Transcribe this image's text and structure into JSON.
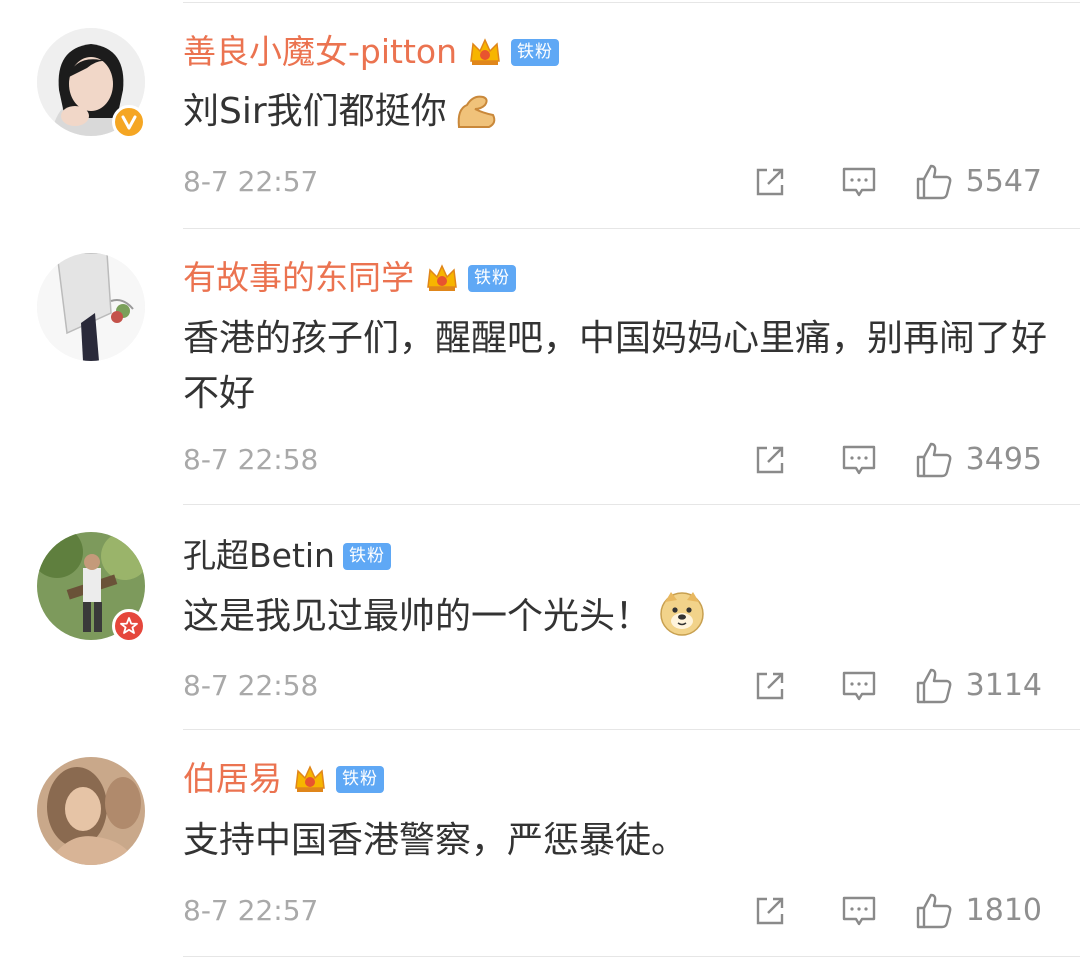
{
  "colors": {
    "vip_name": "#eb7350",
    "plain_name": "#333333",
    "badge_bg": "#5fa8f5",
    "meta": "#a9a9a9"
  },
  "comments": [
    {
      "username": "善良小魔女-pitton",
      "vip": true,
      "badge": "铁粉",
      "text": "刘Sir我们都挺你",
      "emoji": "flexed-biceps",
      "time": "8-7 22:57",
      "likes": "5547",
      "avatar_badge": "verified-gold"
    },
    {
      "username": "有故事的东同学",
      "vip": true,
      "badge": "铁粉",
      "text": "香港的孩子们，醒醒吧，中国妈妈心里痛，别再闹了好不好",
      "time": "8-7 22:58",
      "likes": "3495"
    },
    {
      "username": "孔超Betin",
      "vip": false,
      "badge": "铁粉",
      "text": "这是我见过最帅的一个光头！",
      "emoji": "doge",
      "time": "8-7 22:58",
      "likes": "3114",
      "avatar_badge": "star-red"
    },
    {
      "username": "伯居易",
      "vip": true,
      "badge": "铁粉",
      "text": "支持中国香港警察，严惩暴徒。",
      "time": "8-7 22:57",
      "likes": "1810"
    }
  ]
}
